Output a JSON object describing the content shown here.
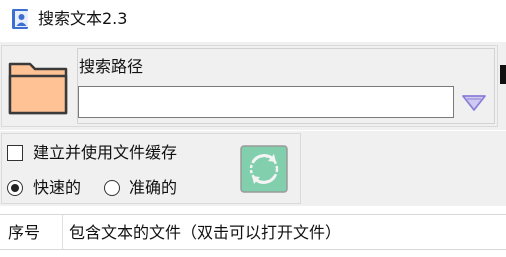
{
  "window": {
    "title": "搜索文本2.3",
    "icon": "person-document-icon"
  },
  "search_path": {
    "label": "搜索路径",
    "value": "",
    "placeholder": ""
  },
  "options": {
    "cache_label": "建立并使用文件缓存",
    "cache_checked": false,
    "modes": [
      {
        "label": "快速的",
        "selected": true
      },
      {
        "label": "准确的",
        "selected": false
      }
    ]
  },
  "results": {
    "columns": [
      "序号",
      "包含文本的文件（双击可以打开文件）"
    ]
  },
  "colors": {
    "folder_fill": "#ffc295",
    "refresh_bg": "#82cfae",
    "dropdown_arrow": "#8a7fd6"
  }
}
